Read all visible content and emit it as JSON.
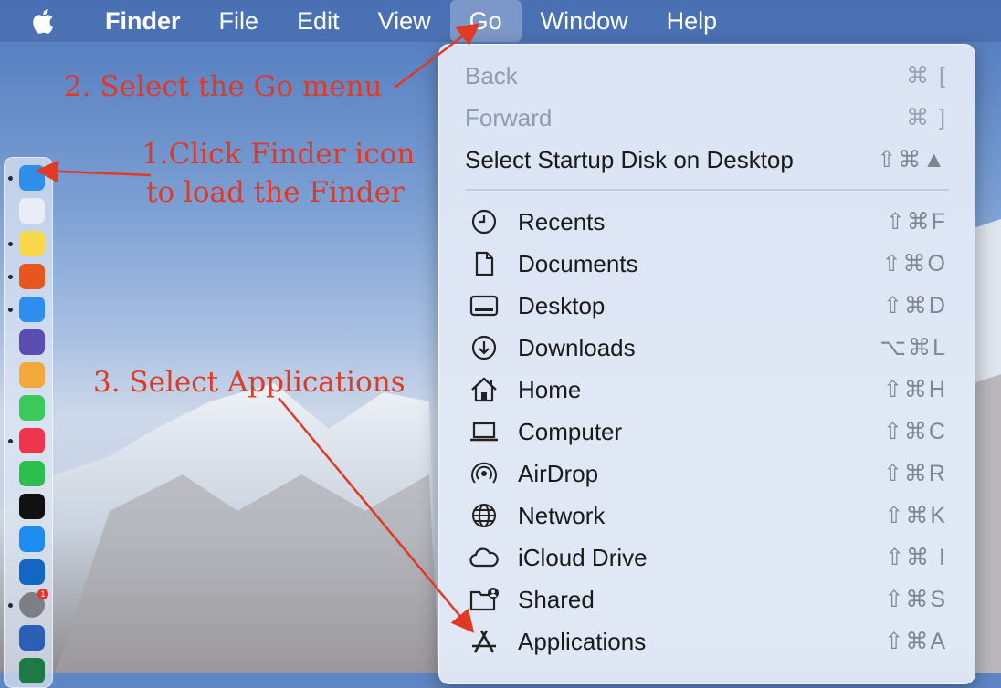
{
  "menubar": {
    "apple": "apple-logo-icon",
    "items": [
      "Finder",
      "File",
      "Edit",
      "View",
      "Go",
      "Window",
      "Help"
    ],
    "active": "Go"
  },
  "annotations": {
    "step1_line1": "1.Click Finder icon",
    "step1_line2": "to load the Finder",
    "step2": "2. Select the Go menu",
    "step3": "3. Select Applications",
    "color": "#e03a25"
  },
  "go_menu": {
    "header_items": [
      {
        "label": "Back",
        "shortcut": "⌘ [",
        "enabled": false
      },
      {
        "label": "Forward",
        "shortcut": "⌘ ]",
        "enabled": false
      },
      {
        "label": "Select Startup Disk on Desktop",
        "shortcut": "⇧⌘▲",
        "enabled": true
      }
    ],
    "items": [
      {
        "label": "Recents",
        "shortcut": "⇧⌘F",
        "icon": "clock-icon"
      },
      {
        "label": "Documents",
        "shortcut": "⇧⌘O",
        "icon": "document-icon"
      },
      {
        "label": "Desktop",
        "shortcut": "⇧⌘D",
        "icon": "desktop-icon"
      },
      {
        "label": "Downloads",
        "shortcut": "⌥⌘L",
        "icon": "download-icon"
      },
      {
        "label": "Home",
        "shortcut": "⇧⌘H",
        "icon": "house-icon"
      },
      {
        "label": "Computer",
        "shortcut": "⇧⌘C",
        "icon": "laptop-icon"
      },
      {
        "label": "AirDrop",
        "shortcut": "⇧⌘R",
        "icon": "airdrop-icon"
      },
      {
        "label": "Network",
        "shortcut": "⇧⌘K",
        "icon": "globe-icon"
      },
      {
        "label": "iCloud Drive",
        "shortcut": "⇧⌘ I",
        "icon": "cloud-icon"
      },
      {
        "label": "Shared",
        "shortcut": "⇧⌘S",
        "icon": "shared-folder-icon"
      },
      {
        "label": "Applications",
        "shortcut": "⇧⌘A",
        "icon": "applications-icon"
      }
    ]
  },
  "dock": {
    "apps": [
      {
        "name": "finder-icon",
        "color": "#2f8fe8",
        "running": true
      },
      {
        "name": "launchpad-icon",
        "color": "#e9eef6",
        "running": false
      },
      {
        "name": "notes-icon",
        "color": "#f7d84a",
        "running": true
      },
      {
        "name": "firefox-icon",
        "color": "#e8561f",
        "running": true
      },
      {
        "name": "safari-icon",
        "color": "#2d8ef0",
        "running": true
      },
      {
        "name": "bbedit-icon",
        "color": "#5b4cb0",
        "running": false
      },
      {
        "name": "photos-icon",
        "color": "#f2a93b",
        "running": false
      },
      {
        "name": "messages-icon",
        "color": "#3cc85a",
        "running": false
      },
      {
        "name": "music-icon",
        "color": "#f1344e",
        "running": true
      },
      {
        "name": "facetime-icon",
        "color": "#2cbf4e",
        "running": false
      },
      {
        "name": "apple-tv-icon",
        "color": "#111111",
        "running": false
      },
      {
        "name": "app-store-icon",
        "color": "#1d8cf0",
        "running": false
      },
      {
        "name": "outlook-icon",
        "color": "#1466c4",
        "running": false
      },
      {
        "name": "system-preferences-icon",
        "color": "#7c7f86",
        "running": true
      },
      {
        "name": "word-icon",
        "color": "#2b5fb4",
        "running": false
      },
      {
        "name": "excel-icon",
        "color": "#1e7a45",
        "running": false
      }
    ],
    "system_preferences_badge": "1"
  }
}
